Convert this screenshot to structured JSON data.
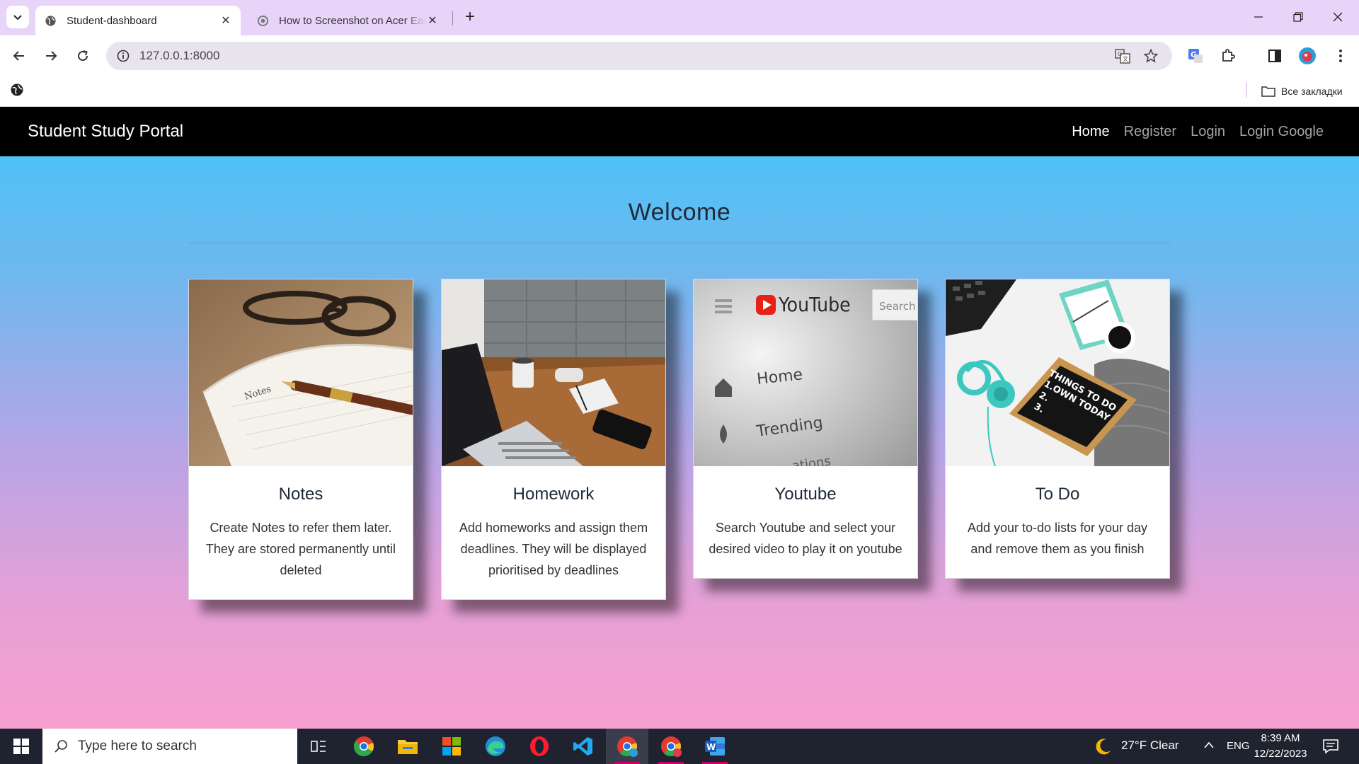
{
  "browser": {
    "tabs": [
      {
        "title": "Student-dashboard",
        "active": true
      },
      {
        "title": "How to Screenshot on Acer Eas",
        "active": false
      }
    ],
    "url": "127.0.0.1:8000",
    "bookmarks_all": "Все закладки"
  },
  "site": {
    "brand": "Student Study Portal",
    "nav": [
      "Home",
      "Register",
      "Login",
      "Login Google"
    ],
    "heading": "Welcome",
    "cards": [
      {
        "title": "Notes",
        "text": "Create Notes to refer them later. They are stored permanently until deleted"
      },
      {
        "title": "Homework",
        "text": "Add homeworks and assign them deadlines. They will be displayed prioritised by deadlines"
      },
      {
        "title": "Youtube",
        "text": "Search Youtube and select your desired video to play it on youtube"
      },
      {
        "title": "To Do",
        "text": "Add your to-do lists for your day and remove them as you finish"
      }
    ],
    "youtube_image": {
      "logo": "YouTube",
      "search": "Search",
      "menu": [
        "Home",
        "Trending",
        "ations"
      ]
    },
    "todo_image": {
      "board": [
        "THINGS TO DO",
        "1.OWN TODAY",
        "2.",
        "3."
      ]
    }
  },
  "taskbar": {
    "search_placeholder": "Type here to search",
    "weather": "27°F  Clear",
    "language": "ENG",
    "time": "8:39 AM",
    "date": "12/22/2023",
    "apps": [
      "task-view",
      "chrome",
      "file-explorer",
      "microsoft-store",
      "edge",
      "opera",
      "vscode",
      "chrome-active",
      "chrome-profile",
      "word"
    ]
  },
  "colors": {
    "tabbar": "#e8d4f8",
    "navbar": "#000000",
    "gradient_top": "#44c6fa",
    "gradient_bottom": "#f7a0cf",
    "taskbar": "#1f2330"
  }
}
